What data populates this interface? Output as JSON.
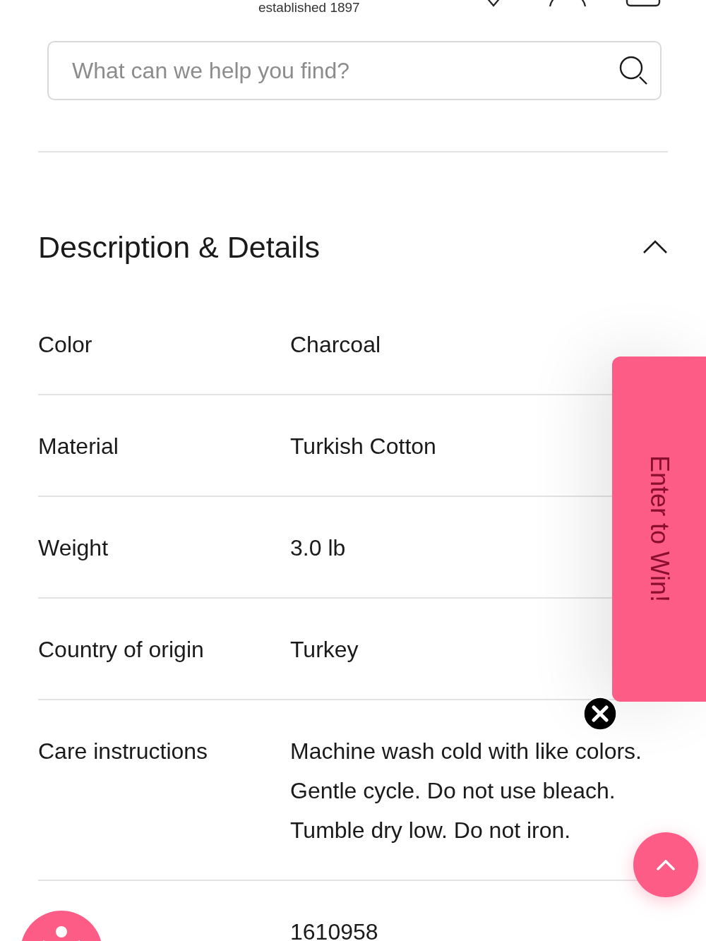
{
  "header": {
    "tagline": "established 1897"
  },
  "search": {
    "placeholder": "What can we help you find?"
  },
  "details": {
    "title": "Description & Details",
    "expanded": true,
    "rows": [
      {
        "label": "Color",
        "value": "Charcoal"
      },
      {
        "label": "Material",
        "value": "Turkish Cotton"
      },
      {
        "label": "Weight",
        "value": "3.0 lb"
      },
      {
        "label": "Country of origin",
        "value": "Turkey"
      },
      {
        "label": "Care instructions",
        "value": "Machine wash cold with like colors. Gentle cycle. Do not use bleach. Tumble dry low. Do not iron."
      },
      {
        "value": "1610958"
      }
    ]
  },
  "promo_tab": {
    "label": "Enter to Win!"
  }
}
